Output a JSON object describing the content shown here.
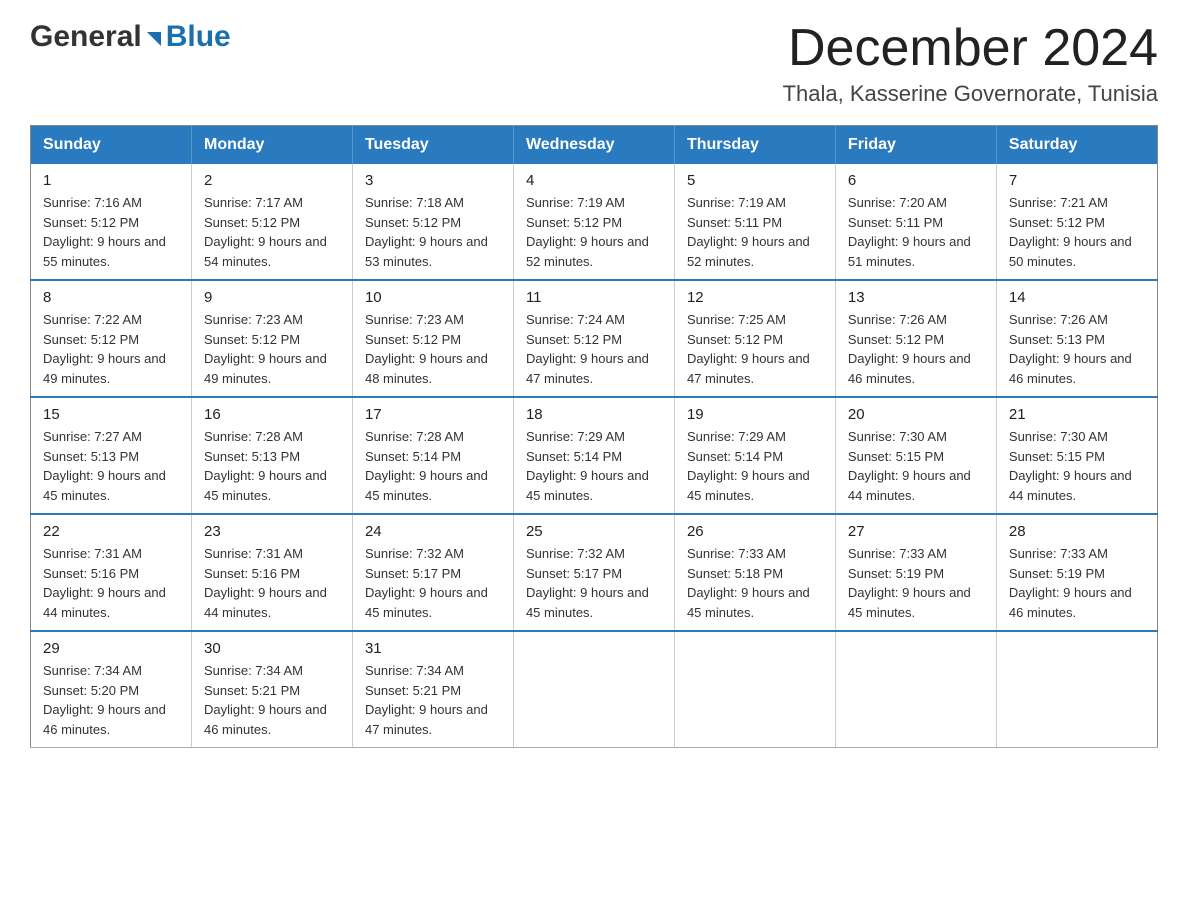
{
  "header": {
    "logo": {
      "general_text": "General",
      "blue_text": "Blue"
    },
    "title": "December 2024",
    "location": "Thala, Kasserine Governorate, Tunisia"
  },
  "calendar": {
    "days_of_week": [
      "Sunday",
      "Monday",
      "Tuesday",
      "Wednesday",
      "Thursday",
      "Friday",
      "Saturday"
    ],
    "weeks": [
      [
        {
          "day": "1",
          "sunrise": "Sunrise: 7:16 AM",
          "sunset": "Sunset: 5:12 PM",
          "daylight": "Daylight: 9 hours and 55 minutes."
        },
        {
          "day": "2",
          "sunrise": "Sunrise: 7:17 AM",
          "sunset": "Sunset: 5:12 PM",
          "daylight": "Daylight: 9 hours and 54 minutes."
        },
        {
          "day": "3",
          "sunrise": "Sunrise: 7:18 AM",
          "sunset": "Sunset: 5:12 PM",
          "daylight": "Daylight: 9 hours and 53 minutes."
        },
        {
          "day": "4",
          "sunrise": "Sunrise: 7:19 AM",
          "sunset": "Sunset: 5:12 PM",
          "daylight": "Daylight: 9 hours and 52 minutes."
        },
        {
          "day": "5",
          "sunrise": "Sunrise: 7:19 AM",
          "sunset": "Sunset: 5:11 PM",
          "daylight": "Daylight: 9 hours and 52 minutes."
        },
        {
          "day": "6",
          "sunrise": "Sunrise: 7:20 AM",
          "sunset": "Sunset: 5:11 PM",
          "daylight": "Daylight: 9 hours and 51 minutes."
        },
        {
          "day": "7",
          "sunrise": "Sunrise: 7:21 AM",
          "sunset": "Sunset: 5:12 PM",
          "daylight": "Daylight: 9 hours and 50 minutes."
        }
      ],
      [
        {
          "day": "8",
          "sunrise": "Sunrise: 7:22 AM",
          "sunset": "Sunset: 5:12 PM",
          "daylight": "Daylight: 9 hours and 49 minutes."
        },
        {
          "day": "9",
          "sunrise": "Sunrise: 7:23 AM",
          "sunset": "Sunset: 5:12 PM",
          "daylight": "Daylight: 9 hours and 49 minutes."
        },
        {
          "day": "10",
          "sunrise": "Sunrise: 7:23 AM",
          "sunset": "Sunset: 5:12 PM",
          "daylight": "Daylight: 9 hours and 48 minutes."
        },
        {
          "day": "11",
          "sunrise": "Sunrise: 7:24 AM",
          "sunset": "Sunset: 5:12 PM",
          "daylight": "Daylight: 9 hours and 47 minutes."
        },
        {
          "day": "12",
          "sunrise": "Sunrise: 7:25 AM",
          "sunset": "Sunset: 5:12 PM",
          "daylight": "Daylight: 9 hours and 47 minutes."
        },
        {
          "day": "13",
          "sunrise": "Sunrise: 7:26 AM",
          "sunset": "Sunset: 5:12 PM",
          "daylight": "Daylight: 9 hours and 46 minutes."
        },
        {
          "day": "14",
          "sunrise": "Sunrise: 7:26 AM",
          "sunset": "Sunset: 5:13 PM",
          "daylight": "Daylight: 9 hours and 46 minutes."
        }
      ],
      [
        {
          "day": "15",
          "sunrise": "Sunrise: 7:27 AM",
          "sunset": "Sunset: 5:13 PM",
          "daylight": "Daylight: 9 hours and 45 minutes."
        },
        {
          "day": "16",
          "sunrise": "Sunrise: 7:28 AM",
          "sunset": "Sunset: 5:13 PM",
          "daylight": "Daylight: 9 hours and 45 minutes."
        },
        {
          "day": "17",
          "sunrise": "Sunrise: 7:28 AM",
          "sunset": "Sunset: 5:14 PM",
          "daylight": "Daylight: 9 hours and 45 minutes."
        },
        {
          "day": "18",
          "sunrise": "Sunrise: 7:29 AM",
          "sunset": "Sunset: 5:14 PM",
          "daylight": "Daylight: 9 hours and 45 minutes."
        },
        {
          "day": "19",
          "sunrise": "Sunrise: 7:29 AM",
          "sunset": "Sunset: 5:14 PM",
          "daylight": "Daylight: 9 hours and 45 minutes."
        },
        {
          "day": "20",
          "sunrise": "Sunrise: 7:30 AM",
          "sunset": "Sunset: 5:15 PM",
          "daylight": "Daylight: 9 hours and 44 minutes."
        },
        {
          "day": "21",
          "sunrise": "Sunrise: 7:30 AM",
          "sunset": "Sunset: 5:15 PM",
          "daylight": "Daylight: 9 hours and 44 minutes."
        }
      ],
      [
        {
          "day": "22",
          "sunrise": "Sunrise: 7:31 AM",
          "sunset": "Sunset: 5:16 PM",
          "daylight": "Daylight: 9 hours and 44 minutes."
        },
        {
          "day": "23",
          "sunrise": "Sunrise: 7:31 AM",
          "sunset": "Sunset: 5:16 PM",
          "daylight": "Daylight: 9 hours and 44 minutes."
        },
        {
          "day": "24",
          "sunrise": "Sunrise: 7:32 AM",
          "sunset": "Sunset: 5:17 PM",
          "daylight": "Daylight: 9 hours and 45 minutes."
        },
        {
          "day": "25",
          "sunrise": "Sunrise: 7:32 AM",
          "sunset": "Sunset: 5:17 PM",
          "daylight": "Daylight: 9 hours and 45 minutes."
        },
        {
          "day": "26",
          "sunrise": "Sunrise: 7:33 AM",
          "sunset": "Sunset: 5:18 PM",
          "daylight": "Daylight: 9 hours and 45 minutes."
        },
        {
          "day": "27",
          "sunrise": "Sunrise: 7:33 AM",
          "sunset": "Sunset: 5:19 PM",
          "daylight": "Daylight: 9 hours and 45 minutes."
        },
        {
          "day": "28",
          "sunrise": "Sunrise: 7:33 AM",
          "sunset": "Sunset: 5:19 PM",
          "daylight": "Daylight: 9 hours and 46 minutes."
        }
      ],
      [
        {
          "day": "29",
          "sunrise": "Sunrise: 7:34 AM",
          "sunset": "Sunset: 5:20 PM",
          "daylight": "Daylight: 9 hours and 46 minutes."
        },
        {
          "day": "30",
          "sunrise": "Sunrise: 7:34 AM",
          "sunset": "Sunset: 5:21 PM",
          "daylight": "Daylight: 9 hours and 46 minutes."
        },
        {
          "day": "31",
          "sunrise": "Sunrise: 7:34 AM",
          "sunset": "Sunset: 5:21 PM",
          "daylight": "Daylight: 9 hours and 47 minutes."
        },
        null,
        null,
        null,
        null
      ]
    ]
  }
}
